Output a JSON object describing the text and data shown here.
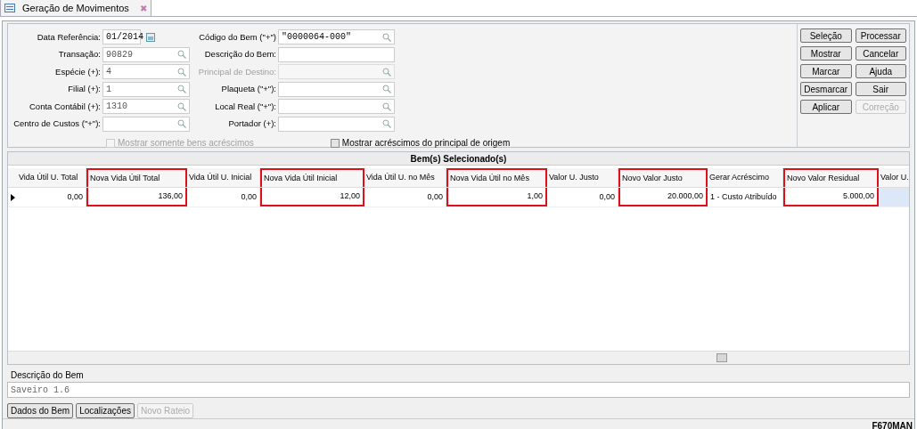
{
  "tab": {
    "title": "Geração de Movimentos",
    "close": "✖"
  },
  "fields_left": [
    {
      "label": "Data Referência:",
      "value": "01/2014",
      "kind": "date",
      "disabled": false
    },
    {
      "label": "Transação:",
      "value": "90829",
      "kind": "lookup",
      "disabled": false
    },
    {
      "label": "Espécie (+):",
      "value": "4",
      "kind": "lookup",
      "disabled": false
    },
    {
      "label": "Filial (+):",
      "value": "1",
      "kind": "lookup",
      "disabled": false
    },
    {
      "label": "Conta Contábil (+):",
      "value": "1310",
      "kind": "lookup",
      "disabled": false
    },
    {
      "label": "Centro de Custos (\"+\"):",
      "kind": "lookup",
      "disabled": false
    }
  ],
  "fields_right": [
    {
      "label": "Código do Bem (\"+\")",
      "value": "\"0000064-000\"",
      "kind": "lookup",
      "disabled": false
    },
    {
      "label": "Descrição do Bem:",
      "kind": "text",
      "disabled": false
    },
    {
      "label": "Principal de Destino:",
      "kind": "lookup",
      "disabled": true
    },
    {
      "label": "Plaqueta (\"+\"):",
      "kind": "lookup",
      "disabled": false
    },
    {
      "label": "Local Real (\"+\"):",
      "kind": "lookup",
      "disabled": false
    },
    {
      "label": "Portador (+):",
      "kind": "lookup",
      "disabled": false
    }
  ],
  "checkboxes": [
    {
      "label": "Mostrar somente bens acréscimos",
      "checked": false,
      "disabled": true
    },
    {
      "label": "Mostrar acréscimos do principal de origem",
      "checked": false,
      "disabled": false
    }
  ],
  "buttons": [
    {
      "label": "Seleção",
      "disabled": false
    },
    {
      "label": "Processar",
      "disabled": false
    },
    {
      "label": "Mostrar",
      "disabled": false
    },
    {
      "label": "Cancelar",
      "disabled": false
    },
    {
      "label": "Marcar",
      "disabled": false
    },
    {
      "label": "Ajuda",
      "disabled": false
    },
    {
      "label": "Desmarcar",
      "disabled": false
    },
    {
      "label": "Sair",
      "disabled": false
    },
    {
      "label": "Aplicar",
      "disabled": false
    },
    {
      "label": "Correção",
      "disabled": true
    }
  ],
  "table": {
    "title": "Bem(s) Selecionado(s)",
    "columns": [
      {
        "label": "Vida Útil U. Total",
        "highlighted": false
      },
      {
        "label": "Nova Vida Útil Total",
        "highlighted": true
      },
      {
        "label": "Vida Útil U. Inicial",
        "highlighted": false
      },
      {
        "label": "Nova Vida Útil Inicial",
        "highlighted": true
      },
      {
        "label": "Vida Útil U. no Mês",
        "highlighted": false
      },
      {
        "label": "Nova Vida Útil no Mês",
        "highlighted": true
      },
      {
        "label": "Valor U. Justo",
        "highlighted": false
      },
      {
        "label": "Novo Valor Justo",
        "highlighted": true
      },
      {
        "label": "Gerar Acréscimo",
        "highlighted": false
      },
      {
        "label": "Novo Valor Residual",
        "highlighted": true
      },
      {
        "label": "Valor U.",
        "highlighted": false
      }
    ],
    "rows": [
      {
        "current": true,
        "cells": [
          "0,00",
          "136,00",
          "0,00",
          "12,00",
          "0,00",
          "1,00",
          "0,00",
          "20.000,00",
          "1 - Custo Atribuído",
          "5.000,00",
          ""
        ]
      }
    ]
  },
  "description": {
    "label": "Descrição do Bem",
    "value": "Saveiro 1.6"
  },
  "bottom_buttons": [
    {
      "label": "Dados do Bem",
      "disabled": false
    },
    {
      "label": "Localizações",
      "disabled": false
    },
    {
      "label": "Novo Rateio",
      "disabled": true
    }
  ],
  "status_bar": {
    "text": "F670MAN"
  }
}
